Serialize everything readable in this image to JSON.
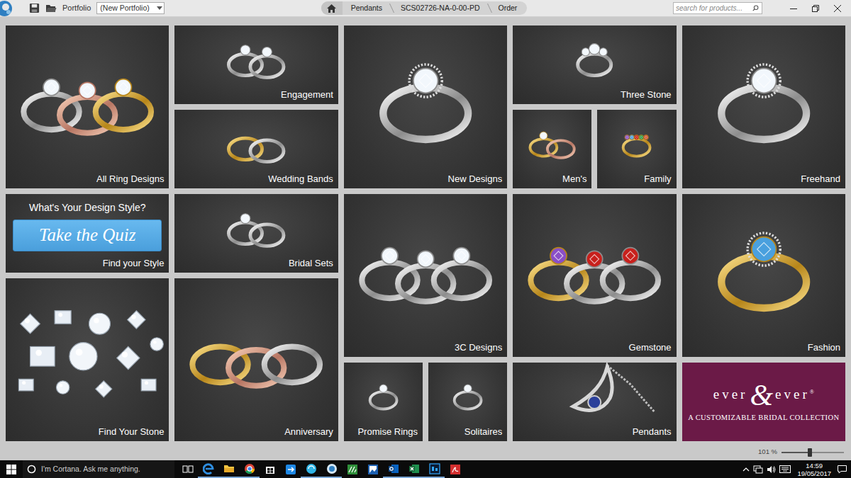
{
  "toolbar": {
    "portfolio_label": "Portfolio",
    "portfolio_value": "(New Portfolio)",
    "breadcrumb": [
      {
        "label": "Pendants"
      },
      {
        "label": "SCS02726-NA-0-00-PD"
      },
      {
        "label": "Order"
      }
    ],
    "search": {
      "placeholder": "search for products..."
    }
  },
  "tiles": [
    {
      "kind": "photo",
      "label": "All Ring Designs"
    },
    {
      "kind": "photo",
      "label": "Engagement"
    },
    {
      "kind": "photo",
      "label": "Wedding Bands"
    },
    {
      "kind": "photo",
      "label": "New Designs"
    },
    {
      "kind": "photo",
      "label": "Three Stone"
    },
    {
      "kind": "photo",
      "label": "Men's"
    },
    {
      "kind": "photo",
      "label": "Family"
    },
    {
      "kind": "photo",
      "label": "Freehand"
    },
    {
      "kind": "quiz",
      "heading": "What's Your Design Style?",
      "button": "Take the Quiz",
      "label": "Find your Style"
    },
    {
      "kind": "photo",
      "label": "Bridal Sets"
    },
    {
      "kind": "photo",
      "label": "3C Designs"
    },
    {
      "kind": "photo",
      "label": "Gemstone"
    },
    {
      "kind": "photo",
      "label": "Fashion"
    },
    {
      "kind": "photo",
      "label": "Find Your Stone"
    },
    {
      "kind": "photo",
      "label": "Anniversary"
    },
    {
      "kind": "photo",
      "label": "Promise Rings"
    },
    {
      "kind": "photo",
      "label": "Solitaires"
    },
    {
      "kind": "photo",
      "label": "Pendants"
    },
    {
      "kind": "brand",
      "brand_left": "ever",
      "brand_amp": "&",
      "brand_right": "ever",
      "trademark": "®",
      "tagline": "A CUSTOMIZABLE BRIDAL COLLECTION"
    }
  ],
  "zoom": {
    "reading": "101 %",
    "level": 0.45
  },
  "taskbar": {
    "search_placeholder": "I'm Cortana. Ask me anything.",
    "time": "14:59",
    "date": "19/05/2017"
  }
}
